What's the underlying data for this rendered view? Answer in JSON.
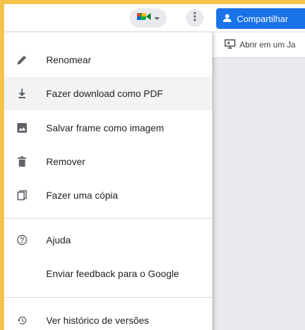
{
  "toolbar": {
    "meet_icon": "google-meet-icon",
    "more_icon": "more-vert-icon",
    "share_label": "Compartilhar"
  },
  "subbar": {
    "open_label": "Abrir em um Ja"
  },
  "menu": {
    "items": [
      {
        "label": "Renomear",
        "icon": "pencil-icon"
      },
      {
        "label": "Fazer download como PDF",
        "icon": "download-icon"
      },
      {
        "label": "Salvar frame como imagem",
        "icon": "image-icon"
      },
      {
        "label": "Remover",
        "icon": "trash-icon"
      },
      {
        "label": "Fazer uma cópia",
        "icon": "copy-icon"
      },
      {
        "label": "Ajuda",
        "icon": "help-icon"
      },
      {
        "label": "Enviar feedback para o Google",
        "icon": ""
      },
      {
        "label": "Ver histórico de versões",
        "icon": "history-icon"
      }
    ]
  },
  "colors": {
    "accent": "#1a73e8",
    "border": "#f5c24a"
  }
}
